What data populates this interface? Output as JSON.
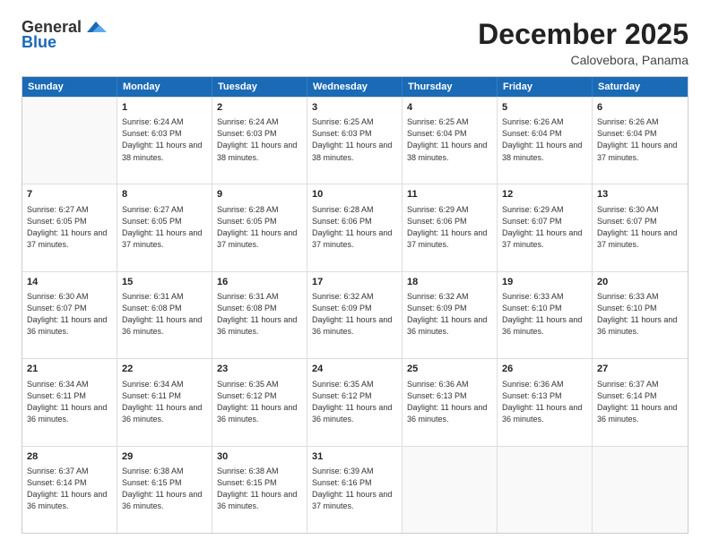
{
  "header": {
    "logo_general": "General",
    "logo_blue": "Blue",
    "month_title": "December 2025",
    "location": "Calovebora, Panama"
  },
  "calendar": {
    "weekdays": [
      "Sunday",
      "Monday",
      "Tuesday",
      "Wednesday",
      "Thursday",
      "Friday",
      "Saturday"
    ],
    "rows": [
      [
        {
          "day": "",
          "empty": true
        },
        {
          "day": "1",
          "sunrise": "Sunrise: 6:24 AM",
          "sunset": "Sunset: 6:03 PM",
          "daylight": "Daylight: 11 hours and 38 minutes."
        },
        {
          "day": "2",
          "sunrise": "Sunrise: 6:24 AM",
          "sunset": "Sunset: 6:03 PM",
          "daylight": "Daylight: 11 hours and 38 minutes."
        },
        {
          "day": "3",
          "sunrise": "Sunrise: 6:25 AM",
          "sunset": "Sunset: 6:03 PM",
          "daylight": "Daylight: 11 hours and 38 minutes."
        },
        {
          "day": "4",
          "sunrise": "Sunrise: 6:25 AM",
          "sunset": "Sunset: 6:04 PM",
          "daylight": "Daylight: 11 hours and 38 minutes."
        },
        {
          "day": "5",
          "sunrise": "Sunrise: 6:26 AM",
          "sunset": "Sunset: 6:04 PM",
          "daylight": "Daylight: 11 hours and 38 minutes."
        },
        {
          "day": "6",
          "sunrise": "Sunrise: 6:26 AM",
          "sunset": "Sunset: 6:04 PM",
          "daylight": "Daylight: 11 hours and 37 minutes."
        }
      ],
      [
        {
          "day": "7",
          "sunrise": "Sunrise: 6:27 AM",
          "sunset": "Sunset: 6:05 PM",
          "daylight": "Daylight: 11 hours and 37 minutes."
        },
        {
          "day": "8",
          "sunrise": "Sunrise: 6:27 AM",
          "sunset": "Sunset: 6:05 PM",
          "daylight": "Daylight: 11 hours and 37 minutes."
        },
        {
          "day": "9",
          "sunrise": "Sunrise: 6:28 AM",
          "sunset": "Sunset: 6:05 PM",
          "daylight": "Daylight: 11 hours and 37 minutes."
        },
        {
          "day": "10",
          "sunrise": "Sunrise: 6:28 AM",
          "sunset": "Sunset: 6:06 PM",
          "daylight": "Daylight: 11 hours and 37 minutes."
        },
        {
          "day": "11",
          "sunrise": "Sunrise: 6:29 AM",
          "sunset": "Sunset: 6:06 PM",
          "daylight": "Daylight: 11 hours and 37 minutes."
        },
        {
          "day": "12",
          "sunrise": "Sunrise: 6:29 AM",
          "sunset": "Sunset: 6:07 PM",
          "daylight": "Daylight: 11 hours and 37 minutes."
        },
        {
          "day": "13",
          "sunrise": "Sunrise: 6:30 AM",
          "sunset": "Sunset: 6:07 PM",
          "daylight": "Daylight: 11 hours and 37 minutes."
        }
      ],
      [
        {
          "day": "14",
          "sunrise": "Sunrise: 6:30 AM",
          "sunset": "Sunset: 6:07 PM",
          "daylight": "Daylight: 11 hours and 36 minutes."
        },
        {
          "day": "15",
          "sunrise": "Sunrise: 6:31 AM",
          "sunset": "Sunset: 6:08 PM",
          "daylight": "Daylight: 11 hours and 36 minutes."
        },
        {
          "day": "16",
          "sunrise": "Sunrise: 6:31 AM",
          "sunset": "Sunset: 6:08 PM",
          "daylight": "Daylight: 11 hours and 36 minutes."
        },
        {
          "day": "17",
          "sunrise": "Sunrise: 6:32 AM",
          "sunset": "Sunset: 6:09 PM",
          "daylight": "Daylight: 11 hours and 36 minutes."
        },
        {
          "day": "18",
          "sunrise": "Sunrise: 6:32 AM",
          "sunset": "Sunset: 6:09 PM",
          "daylight": "Daylight: 11 hours and 36 minutes."
        },
        {
          "day": "19",
          "sunrise": "Sunrise: 6:33 AM",
          "sunset": "Sunset: 6:10 PM",
          "daylight": "Daylight: 11 hours and 36 minutes."
        },
        {
          "day": "20",
          "sunrise": "Sunrise: 6:33 AM",
          "sunset": "Sunset: 6:10 PM",
          "daylight": "Daylight: 11 hours and 36 minutes."
        }
      ],
      [
        {
          "day": "21",
          "sunrise": "Sunrise: 6:34 AM",
          "sunset": "Sunset: 6:11 PM",
          "daylight": "Daylight: 11 hours and 36 minutes."
        },
        {
          "day": "22",
          "sunrise": "Sunrise: 6:34 AM",
          "sunset": "Sunset: 6:11 PM",
          "daylight": "Daylight: 11 hours and 36 minutes."
        },
        {
          "day": "23",
          "sunrise": "Sunrise: 6:35 AM",
          "sunset": "Sunset: 6:12 PM",
          "daylight": "Daylight: 11 hours and 36 minutes."
        },
        {
          "day": "24",
          "sunrise": "Sunrise: 6:35 AM",
          "sunset": "Sunset: 6:12 PM",
          "daylight": "Daylight: 11 hours and 36 minutes."
        },
        {
          "day": "25",
          "sunrise": "Sunrise: 6:36 AM",
          "sunset": "Sunset: 6:13 PM",
          "daylight": "Daylight: 11 hours and 36 minutes."
        },
        {
          "day": "26",
          "sunrise": "Sunrise: 6:36 AM",
          "sunset": "Sunset: 6:13 PM",
          "daylight": "Daylight: 11 hours and 36 minutes."
        },
        {
          "day": "27",
          "sunrise": "Sunrise: 6:37 AM",
          "sunset": "Sunset: 6:14 PM",
          "daylight": "Daylight: 11 hours and 36 minutes."
        }
      ],
      [
        {
          "day": "28",
          "sunrise": "Sunrise: 6:37 AM",
          "sunset": "Sunset: 6:14 PM",
          "daylight": "Daylight: 11 hours and 36 minutes."
        },
        {
          "day": "29",
          "sunrise": "Sunrise: 6:38 AM",
          "sunset": "Sunset: 6:15 PM",
          "daylight": "Daylight: 11 hours and 36 minutes."
        },
        {
          "day": "30",
          "sunrise": "Sunrise: 6:38 AM",
          "sunset": "Sunset: 6:15 PM",
          "daylight": "Daylight: 11 hours and 36 minutes."
        },
        {
          "day": "31",
          "sunrise": "Sunrise: 6:39 AM",
          "sunset": "Sunset: 6:16 PM",
          "daylight": "Daylight: 11 hours and 37 minutes."
        },
        {
          "day": "",
          "empty": true
        },
        {
          "day": "",
          "empty": true
        },
        {
          "day": "",
          "empty": true
        }
      ]
    ]
  }
}
